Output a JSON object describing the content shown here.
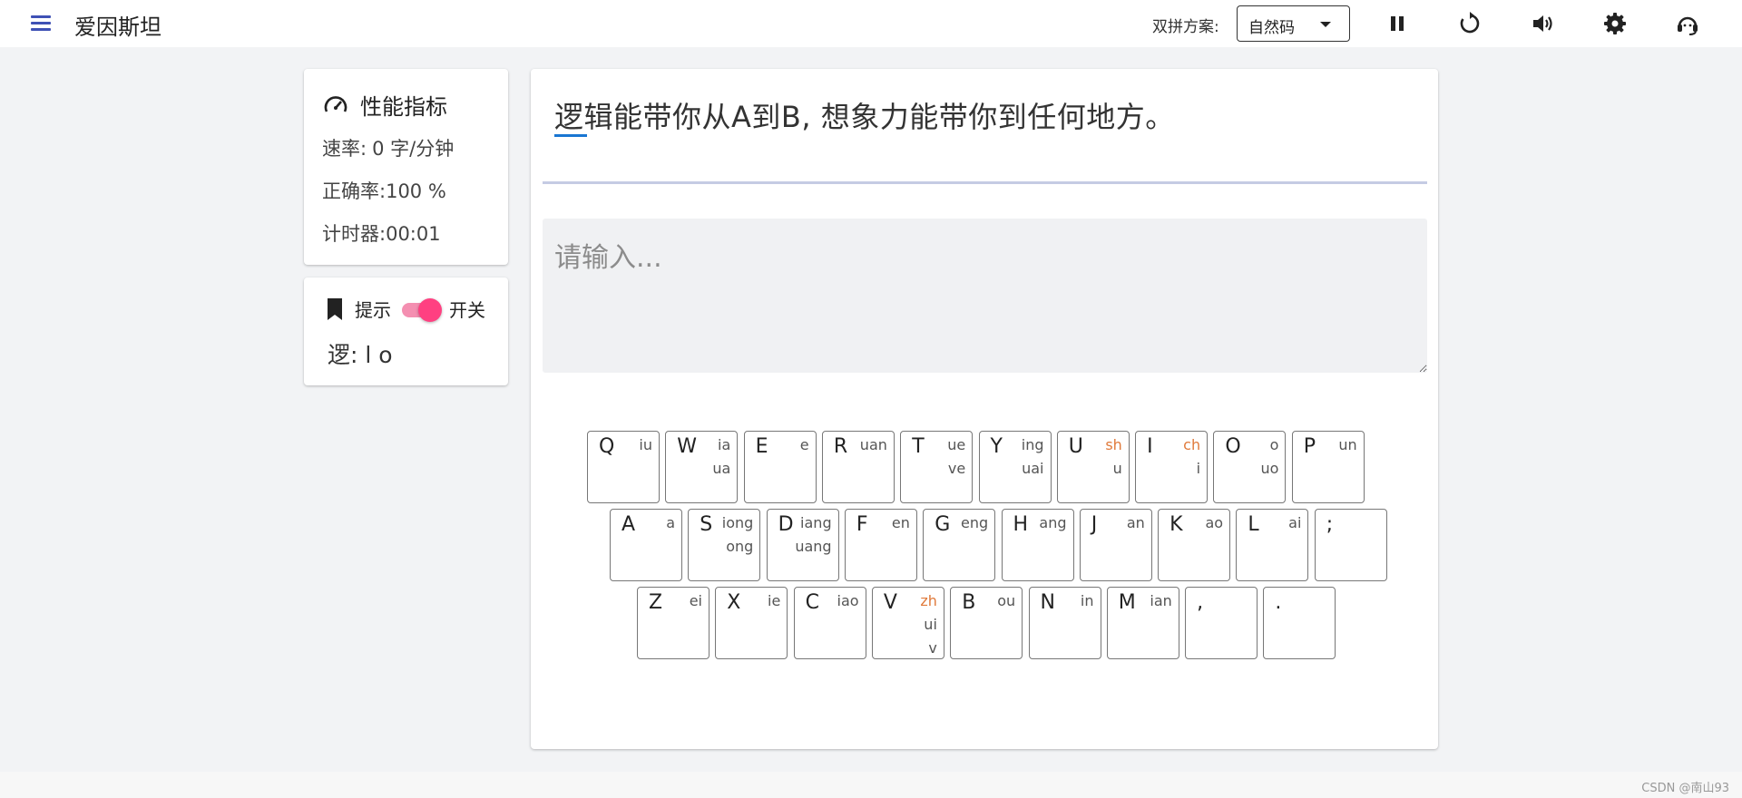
{
  "app": {
    "title": "爱因斯坦"
  },
  "toolbar": {
    "scheme_label": "双拼方案:",
    "scheme_value": "自然码",
    "icons": [
      "pause-icon",
      "restart-icon",
      "volume-icon",
      "settings-icon",
      "headset-icon"
    ]
  },
  "metrics": {
    "title": "性能指标",
    "speed_label": "速率:",
    "speed_value": "0 字/分钟",
    "accuracy_label": "正确率:",
    "accuracy_value": "100 %",
    "timer_label": "计时器:",
    "timer_value": "00:01"
  },
  "hint": {
    "label": "提示",
    "switch_label": "开关",
    "switch_on": true,
    "char_hint": "逻: l o"
  },
  "practice": {
    "target_text": "逻辑能带你从A到B, 想象力能带你到任何地方。",
    "input_placeholder": "请输入..."
  },
  "colors": {
    "accent": "#3f51b5",
    "toggle": "#ff4081",
    "highlight": "#e07a3b",
    "cursor": "#1976d2"
  },
  "keyboard": {
    "rows": [
      [
        {
          "key": "Q",
          "subs": [
            "iu"
          ]
        },
        {
          "key": "W",
          "subs": [
            "ia",
            "ua"
          ]
        },
        {
          "key": "E",
          "subs": [
            "e"
          ]
        },
        {
          "key": "R",
          "subs": [
            "uan"
          ]
        },
        {
          "key": "T",
          "subs": [
            "ue",
            "ve"
          ]
        },
        {
          "key": "Y",
          "subs": [
            "ing",
            "uai"
          ]
        },
        {
          "key": "U",
          "subs": [
            "sh",
            "u"
          ],
          "hl": 0
        },
        {
          "key": "I",
          "subs": [
            "ch",
            "i"
          ],
          "hl": 0
        },
        {
          "key": "O",
          "subs": [
            "o",
            "uo"
          ]
        },
        {
          "key": "P",
          "subs": [
            "un"
          ]
        }
      ],
      [
        {
          "key": "A",
          "subs": [
            "a"
          ]
        },
        {
          "key": "S",
          "subs": [
            "iong",
            "ong"
          ]
        },
        {
          "key": "D",
          "subs": [
            "iang",
            "uang"
          ]
        },
        {
          "key": "F",
          "subs": [
            "en"
          ]
        },
        {
          "key": "G",
          "subs": [
            "eng"
          ]
        },
        {
          "key": "H",
          "subs": [
            "ang"
          ]
        },
        {
          "key": "J",
          "subs": [
            "an"
          ]
        },
        {
          "key": "K",
          "subs": [
            "ao"
          ]
        },
        {
          "key": "L",
          "subs": [
            "ai"
          ]
        },
        {
          "key": ";",
          "subs": []
        }
      ],
      [
        {
          "key": "Z",
          "subs": [
            "ei"
          ]
        },
        {
          "key": "X",
          "subs": [
            "ie"
          ]
        },
        {
          "key": "C",
          "subs": [
            "iao"
          ]
        },
        {
          "key": "V",
          "subs": [
            "zh",
            "ui",
            "v"
          ],
          "hl": 0
        },
        {
          "key": "B",
          "subs": [
            "ou"
          ]
        },
        {
          "key": "N",
          "subs": [
            "in"
          ]
        },
        {
          "key": "M",
          "subs": [
            "ian"
          ]
        },
        {
          "key": ",",
          "subs": []
        },
        {
          "key": ".",
          "subs": []
        }
      ]
    ]
  },
  "footer": {
    "watermark": "CSDN @南山93"
  }
}
